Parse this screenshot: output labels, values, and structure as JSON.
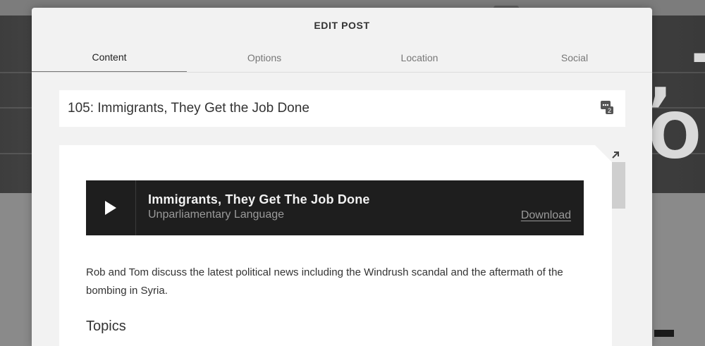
{
  "modal": {
    "title": "EDIT POST",
    "tabs": [
      {
        "label": "Content",
        "active": true
      },
      {
        "label": "Options",
        "active": false
      },
      {
        "label": "Location",
        "active": false
      },
      {
        "label": "Social",
        "active": false
      }
    ]
  },
  "post": {
    "title": "105: Immigrants, They Get the Job Done",
    "counter_icon": "comment-count-icon",
    "counter_value": "2"
  },
  "player": {
    "track_title": "Immigrants, They Get The Job Done",
    "show_name": "Unparliamentary Language",
    "download_label": "Download"
  },
  "content": {
    "paragraph": "Rob and Tom discuss the latest political news including the Windrush scandal and the aftermath of the bombing in Syria.",
    "topics_heading": "Topics"
  },
  "background": {
    "hero_text": ", T\nO"
  },
  "colors": {
    "player_bg": "#1e1e1e",
    "modal_bg": "#f2f2f2",
    "active_tab_border": "#777777"
  }
}
